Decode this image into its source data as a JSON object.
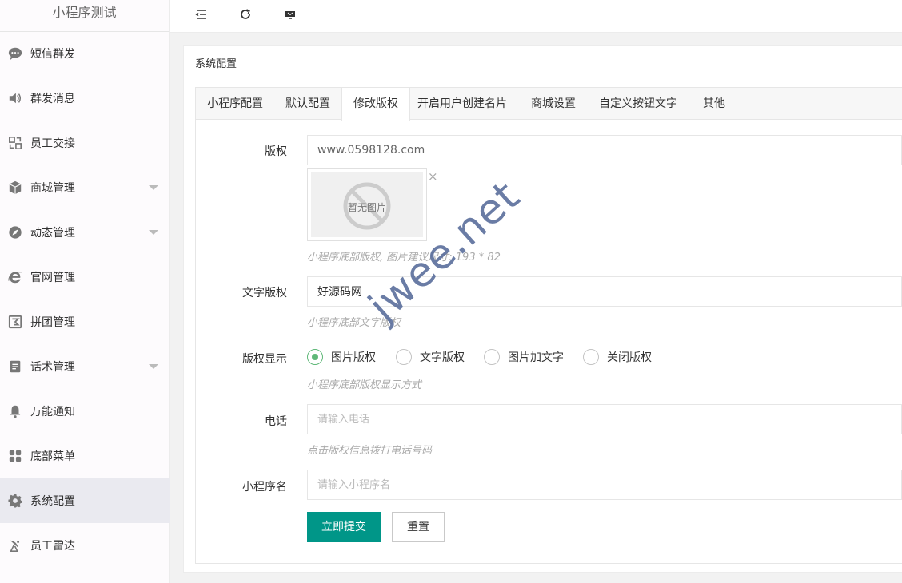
{
  "app": {
    "title": "小程序测试"
  },
  "sidebar": {
    "items": [
      {
        "label": "短信群发",
        "icon": "chat-bubble-icon"
      },
      {
        "label": "群发消息",
        "icon": "speaker-icon"
      },
      {
        "label": "员工交接",
        "icon": "handover-icon"
      },
      {
        "label": "商城管理",
        "icon": "cube-icon",
        "expandable": true
      },
      {
        "label": "动态管理",
        "icon": "compass-icon",
        "expandable": true
      },
      {
        "label": "官网管理",
        "icon": "ie-browser-icon"
      },
      {
        "label": "拼团管理",
        "icon": "group-icon"
      },
      {
        "label": "话术管理",
        "icon": "document-icon",
        "expandable": true
      },
      {
        "label": "万能通知",
        "icon": "bell-icon"
      },
      {
        "label": "底部菜单",
        "icon": "grid-icon"
      },
      {
        "label": "系统配置",
        "icon": "gear-icon",
        "active": true
      },
      {
        "label": "员工雷达",
        "icon": "satellite-dish-icon"
      }
    ]
  },
  "topbar": {
    "tools": [
      "menu-collapse-icon",
      "refresh-icon",
      "monitor-icon"
    ]
  },
  "panel": {
    "title": "系统配置"
  },
  "tabs": [
    {
      "label": "小程序配置"
    },
    {
      "label": "默认配置"
    },
    {
      "label": "修改版权",
      "active": true
    },
    {
      "label": "开启用户创建名片"
    },
    {
      "label": "商城设置"
    },
    {
      "label": "自定义按钮文字"
    },
    {
      "label": "其他"
    }
  ],
  "form": {
    "copyright": {
      "label": "版权",
      "value": "www.0598128.com",
      "image_placeholder": "暂无图片",
      "close_glyph": "×",
      "hint": "小程序底部版权, 图片建议尺寸: 193 * 82"
    },
    "text_copyright": {
      "label": "文字版权",
      "value": "好源码网",
      "hint": "小程序底部文字版权"
    },
    "display": {
      "label": "版权显示",
      "options": [
        "图片版权",
        "文字版权",
        "图片加文字",
        "关闭版权"
      ],
      "selected": "图片版权",
      "hint": "小程序底部版权显示方式"
    },
    "phone": {
      "label": "电话",
      "value": "",
      "placeholder": "请输入电话",
      "hint": "点击版权信息拨打电话号码"
    },
    "app_name": {
      "label": "小程序名",
      "value": "",
      "placeholder": "请输入小程序名"
    },
    "submit_label": "立即提交",
    "reset_label": "重置"
  },
  "watermark": "jwee.net",
  "colors": {
    "primary": "#009688",
    "radio_checked": "#5fb878",
    "active_menu_bg": "#eaeaf0"
  }
}
